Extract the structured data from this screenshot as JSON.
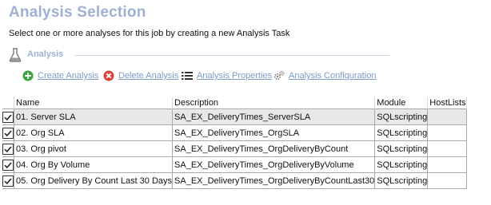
{
  "header": {
    "title": "Analysis Selection",
    "subtitle": "Select one or more analyses for this job by creating a new Analysis Task"
  },
  "section": {
    "label": "Analysis"
  },
  "toolbar": {
    "create": "Create Analysis",
    "delete": "Delete Analysis",
    "properties": "Analysis Properties",
    "configuration": "Analysis Configuration"
  },
  "colors": {
    "title": "#9fb1d3",
    "link": "#7a9cc6",
    "create_icon": "#3aa53a",
    "delete_icon": "#d9443a"
  },
  "icons": {
    "section": "flask-icon",
    "create": "plus-circle-icon",
    "delete": "x-circle-icon",
    "properties": "list-icon",
    "configuration": "gears-icon"
  },
  "table": {
    "columns": [
      "Name",
      "Description",
      "Module",
      "HostLists"
    ],
    "rows": [
      {
        "checked": true,
        "name": "01. Server SLA",
        "description": "SA_EX_DeliveryTimes_ServerSLA",
        "module": "SQLscripting",
        "hostlists": ""
      },
      {
        "checked": true,
        "name": "02. Org SLA",
        "description": "SA_EX_DeliveryTimes_OrgSLA",
        "module": "SQLscripting",
        "hostlists": ""
      },
      {
        "checked": true,
        "name": "03. Org pivot",
        "description": "SA_EX_DeliveryTimes_OrgDeliveryByCount",
        "module": "SQLscripting",
        "hostlists": ""
      },
      {
        "checked": true,
        "name": "04. Org By Volume",
        "description": "SA_EX_DeliveryTimes_OrgDeliveryByVolume",
        "module": "SQLscripting",
        "hostlists": ""
      },
      {
        "checked": true,
        "name": "05. Org Delivery By Count Last 30 Days",
        "description": "SA_EX_DeliveryTimes_OrgDeliveryByCountLast30",
        "module": "SQLscripting",
        "hostlists": ""
      }
    ]
  }
}
